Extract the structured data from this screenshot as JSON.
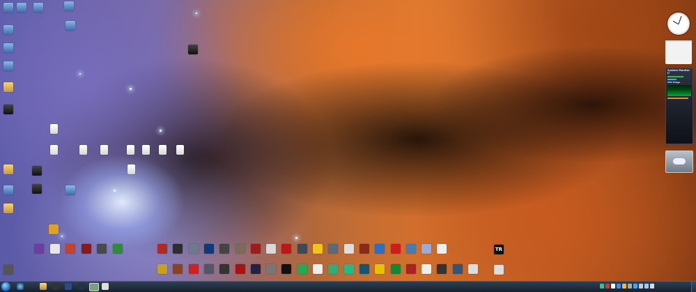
{
  "desktop": {
    "left_column": [
      {
        "label": "",
        "kind": "sys"
      },
      {
        "label": "",
        "kind": "sys"
      },
      {
        "label": "",
        "kind": "sys"
      },
      {
        "label": "",
        "kind": "sys"
      },
      {
        "label": "",
        "kind": "folder"
      },
      {
        "label": "",
        "kind": "app"
      },
      {
        "label": "",
        "kind": "folder"
      },
      {
        "label": "",
        "kind": "sys"
      },
      {
        "label": "",
        "kind": "folder"
      }
    ],
    "top_row": [
      {
        "label": ""
      },
      {
        "label": ""
      },
      {
        "label": ""
      },
      {
        "label": ""
      },
      {
        "label": ""
      }
    ],
    "docs_row": [
      {
        "label": ""
      },
      {
        "label": ""
      },
      {
        "label": ""
      },
      {
        "label": ""
      },
      {
        "label": ""
      },
      {
        "label": ""
      },
      {
        "label": ""
      },
      {
        "label": ""
      }
    ],
    "game_row_1": [
      {
        "label": "",
        "color": "#b22a1f"
      },
      {
        "label": "",
        "color": "#2d2d2d"
      },
      {
        "label": "",
        "color": "#6c7b8b"
      },
      {
        "label": "",
        "color": "#0e3a7a"
      },
      {
        "label": "",
        "color": "#444444"
      },
      {
        "label": "",
        "color": "#7a6b5a"
      },
      {
        "label": "",
        "color": "#a11b1b"
      },
      {
        "label": "",
        "color": "#d9d9d9"
      },
      {
        "label": "",
        "color": "#c0161a"
      },
      {
        "label": "",
        "color": "#3a4a5a"
      },
      {
        "label": "",
        "color": "#f0c419"
      },
      {
        "label": "",
        "color": "#5a6a7a"
      },
      {
        "label": "",
        "color": "#dddddd"
      },
      {
        "label": "",
        "color": "#8a2a1a"
      },
      {
        "label": "",
        "color": "#2a6fc4"
      },
      {
        "label": "",
        "color": "#d01c1c"
      },
      {
        "label": "",
        "color": "#4a7ab0"
      },
      {
        "label": "",
        "color": "#9ad"
      },
      {
        "label": "",
        "color": "#eeeeee"
      }
    ],
    "game_row_2": [
      {
        "label": "",
        "color": "#c8a020"
      },
      {
        "label": "",
        "color": "#884422"
      },
      {
        "label": "",
        "color": "#c22"
      },
      {
        "label": "",
        "color": "#556"
      },
      {
        "label": "",
        "color": "#333"
      },
      {
        "label": "",
        "color": "#a11"
      },
      {
        "label": "",
        "color": "#224"
      },
      {
        "label": "",
        "color": "#777"
      },
      {
        "label": "",
        "color": "#111"
      },
      {
        "label": "",
        "color": "#2a5"
      },
      {
        "label": "",
        "color": "#eee"
      },
      {
        "label": "",
        "color": "#3a7"
      },
      {
        "label": "",
        "color": "#2b8"
      },
      {
        "label": "",
        "color": "#157"
      },
      {
        "label": "",
        "color": "#e8c200"
      },
      {
        "label": "",
        "color": "#183"
      },
      {
        "label": "",
        "color": "#a22"
      },
      {
        "label": "",
        "color": "#eee"
      },
      {
        "label": "",
        "color": "#333"
      },
      {
        "label": "",
        "color": "#357"
      },
      {
        "label": "",
        "color": "#ddd"
      }
    ],
    "lower_left_row": [
      {
        "label": "",
        "color": "#6b3fa0"
      },
      {
        "label": "",
        "color": "#e6e6e6"
      },
      {
        "label": "",
        "color": "#c9412a"
      },
      {
        "label": "",
        "color": "#8a1a1a"
      },
      {
        "label": "",
        "color": "#4a4a4a"
      },
      {
        "label": "",
        "color": "#2f8a3a"
      }
    ],
    "right_tr_icon": {
      "label": "TR",
      "color": "#111111"
    }
  },
  "gadgets": {
    "calendar": {
      "month_label": "",
      "days": [
        "",
        "",
        "",
        "",
        "",
        "",
        "",
        "",
        "",
        "",
        "",
        "",
        "",
        ""
      ]
    },
    "system_monitor": {
      "title": "System Monitor II",
      "rows": [
        "",
        "",
        "",
        "",
        "",
        ""
      ],
      "cpu_label": "CPU Usage"
    }
  },
  "taskbar": {
    "clock_time": "",
    "clock_date": ""
  }
}
